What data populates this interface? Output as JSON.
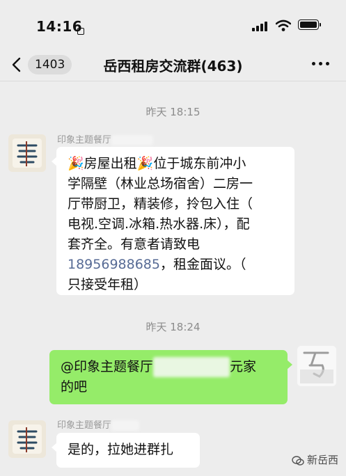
{
  "status_bar": {
    "time": "14:16"
  },
  "header": {
    "back_badge": "1403",
    "title": "岳西租房交流群(463)"
  },
  "messages": [
    {
      "timestamp": "昨天 18:15",
      "sender": "印象主题餐厅",
      "line1": "🎉房屋出租🎉位于城东前冲小",
      "line2": "学隔壁（林业总场宿舍）二房一",
      "line3": "厅带厨卫，精装修，拎包入住（",
      "line4": "电视.空调.冰箱.热水器.床），配",
      "line5": "套齐全。有意者请致电",
      "phone": "18956988685",
      "line6_rest": "，租金面议。（",
      "line7": "只接受年租）"
    },
    {
      "timestamp": "昨天 18:24",
      "mention": "@印象主题餐厅",
      "line1_rest": "元家",
      "line2": "的吧"
    },
    {
      "sender": "印象主题餐厅",
      "text": "是的，拉她进群扎"
    }
  ],
  "watermark": {
    "text": "新岳西"
  },
  "icons": {
    "back": "chevron-left-icon",
    "more": "more-dots-icon",
    "signal": "signal-icon",
    "wifi": "wifi-icon",
    "battery": "battery-icon"
  }
}
